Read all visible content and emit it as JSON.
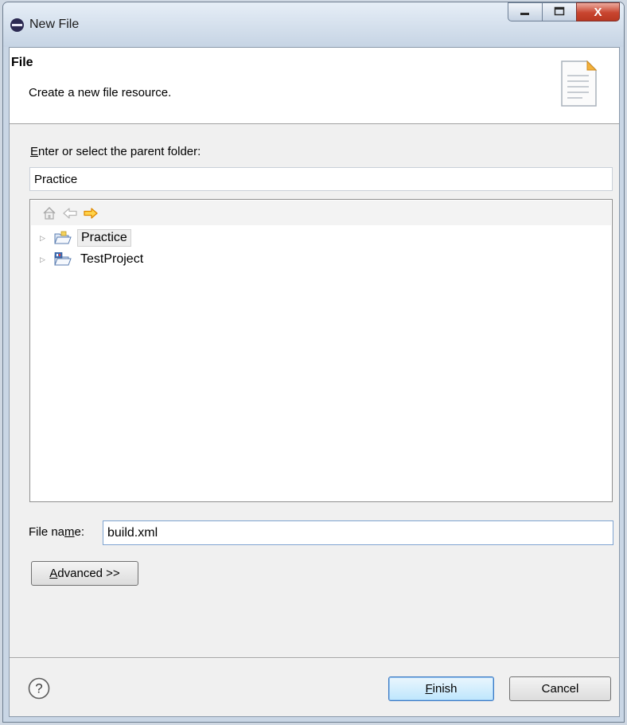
{
  "window": {
    "title": "New File",
    "controls": {
      "minimize": "—",
      "maximize": "□",
      "close": "X"
    }
  },
  "header": {
    "title": "File",
    "description": "Create a new file resource."
  },
  "parent_folder": {
    "label_first": "E",
    "label_rest": "nter or select the parent folder:",
    "value": "Practice"
  },
  "tree": {
    "toolbar": [
      "home-icon",
      "back-arrow-icon",
      "forward-arrow-icon"
    ],
    "items": [
      {
        "label": "Practice",
        "selected": true
      },
      {
        "label": "TestProject",
        "selected": false
      }
    ]
  },
  "file_name": {
    "label_prefix": "File na",
    "label_mnemonic": "m",
    "label_suffix": "e:",
    "value": "build.xml"
  },
  "advanced_button": {
    "mnemonic": "A",
    "rest": "dvanced >>"
  },
  "footer": {
    "finish_mnemonic": "F",
    "finish_rest": "inish",
    "cancel": "Cancel"
  },
  "colors": {
    "accent": "#3d7bc4",
    "close_button": "#c8452f",
    "forward_arrow": "#e8a800"
  }
}
